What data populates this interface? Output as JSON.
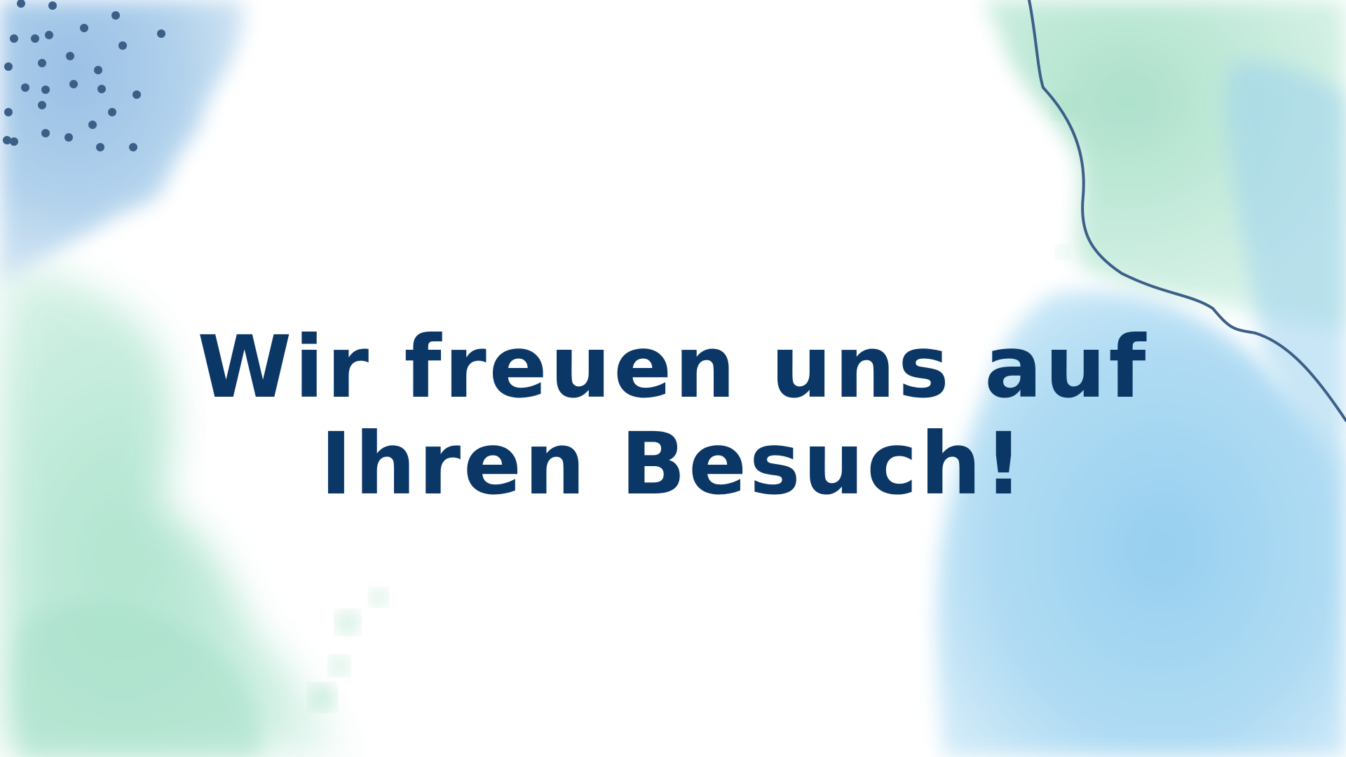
{
  "slide": {
    "headline_line1": "Wir freuen uns auf",
    "headline_line2": "Ihren Besuch!"
  },
  "colors": {
    "background": "#ffffff",
    "text": "#0b3766",
    "watercolor_blue": "#a9cdea",
    "watercolor_mint": "#b6e6d2",
    "watercolor_sky": "#9fd3f0",
    "accent_line": "#3c5f88",
    "dots": "#3c5f88"
  }
}
